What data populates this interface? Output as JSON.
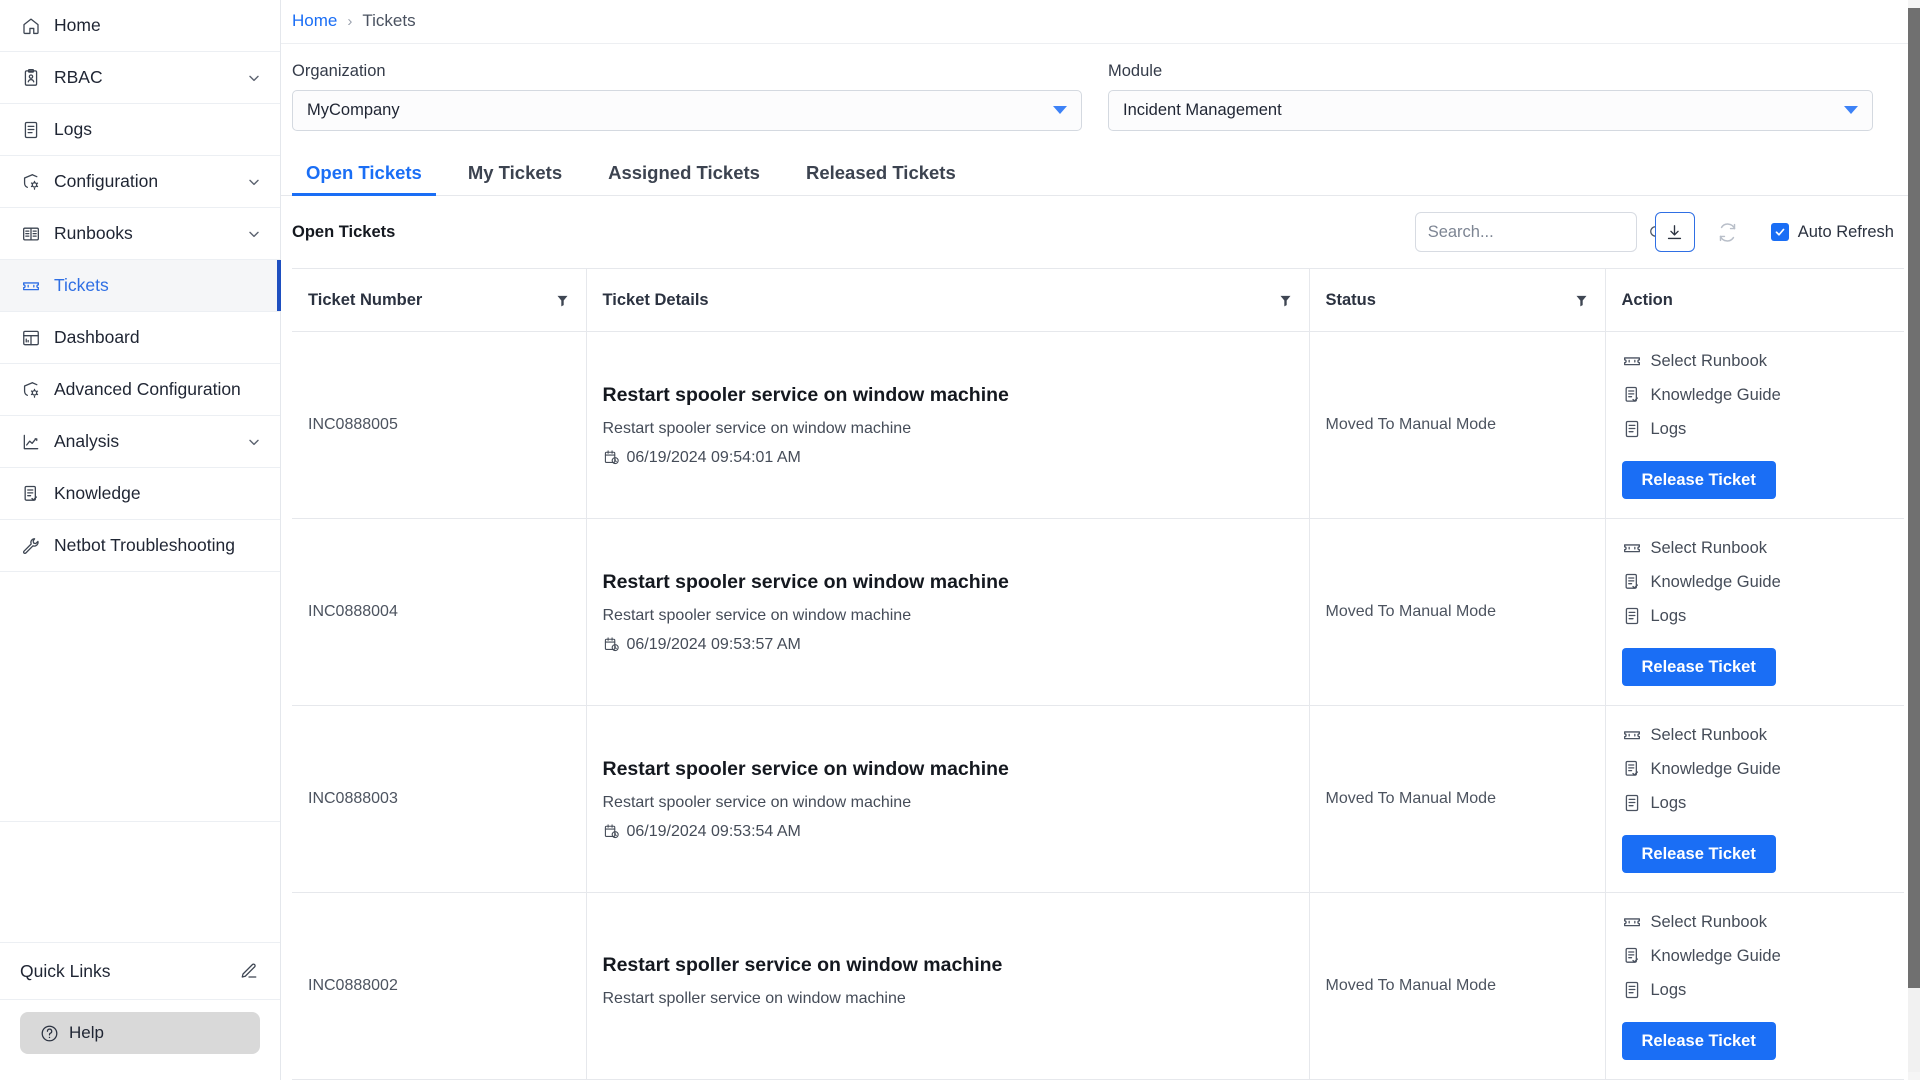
{
  "sidebar": {
    "items": [
      {
        "label": "Home",
        "icon": "home-icon",
        "expandable": false,
        "active": false
      },
      {
        "label": "RBAC",
        "icon": "clipboard-user-icon",
        "expandable": true,
        "active": false
      },
      {
        "label": "Logs",
        "icon": "file-lines-icon",
        "expandable": false,
        "active": false
      },
      {
        "label": "Configuration",
        "icon": "gear-settings-icon",
        "expandable": true,
        "active": false
      },
      {
        "label": "Runbooks",
        "icon": "book-open-icon",
        "expandable": true,
        "active": false
      },
      {
        "label": "Tickets",
        "icon": "ticket-icon",
        "expandable": false,
        "active": true
      },
      {
        "label": "Dashboard",
        "icon": "dashboard-grid-icon",
        "expandable": false,
        "active": false
      },
      {
        "label": "Advanced Configuration",
        "icon": "gear-settings-icon",
        "expandable": false,
        "active": false
      },
      {
        "label": "Analysis",
        "icon": "chart-line-icon",
        "expandable": true,
        "active": false
      },
      {
        "label": "Knowledge",
        "icon": "file-check-icon",
        "expandable": false,
        "active": false
      },
      {
        "label": "Netbot Troubleshooting",
        "icon": "wrench-icon",
        "expandable": false,
        "active": false
      }
    ],
    "quick_links": {
      "label": "Quick Links",
      "edit_icon": "pencil-icon"
    },
    "help": {
      "label": "Help",
      "icon": "question-circle-icon"
    }
  },
  "breadcrumb": {
    "home": "Home",
    "separator": "›",
    "current": "Tickets"
  },
  "filters": {
    "organization": {
      "label": "Organization",
      "value": "MyCompany"
    },
    "module": {
      "label": "Module",
      "value": "Incident Management"
    }
  },
  "tabs": [
    {
      "label": "Open Tickets",
      "active": true
    },
    {
      "label": "My Tickets",
      "active": false
    },
    {
      "label": "Assigned Tickets",
      "active": false
    },
    {
      "label": "Released Tickets",
      "active": false
    }
  ],
  "panel": {
    "title": "Open Tickets",
    "search_placeholder": "Search...",
    "search_value": "",
    "download_icon": "download-icon",
    "refresh_icon": "refresh-icon",
    "auto_refresh_label": "Auto Refresh",
    "auto_refresh_checked": true
  },
  "table": {
    "columns": [
      {
        "label": "Ticket Number",
        "filter": true
      },
      {
        "label": "Ticket Details",
        "filter": true
      },
      {
        "label": "Status",
        "filter": true
      },
      {
        "label": "Action",
        "filter": false
      }
    ],
    "rows": [
      {
        "number": "INC0888005",
        "title": "Restart spooler service on window machine",
        "subtitle": "Restart spooler service on window machine",
        "date": "06/19/2024 09:54:01 AM",
        "status": "Moved To Manual Mode",
        "actions": [
          {
            "label": "Select Runbook",
            "icon": "ticket-icon"
          },
          {
            "label": "Knowledge Guide",
            "icon": "file-check-icon"
          },
          {
            "label": "Logs",
            "icon": "file-lines-icon"
          }
        ],
        "release_label": "Release Ticket"
      },
      {
        "number": "INC0888004",
        "title": "Restart spooler service on window machine",
        "subtitle": "Restart spooler service on window machine",
        "date": "06/19/2024 09:53:57 AM",
        "status": "Moved To Manual Mode",
        "actions": [
          {
            "label": "Select Runbook",
            "icon": "ticket-icon"
          },
          {
            "label": "Knowledge Guide",
            "icon": "file-check-icon"
          },
          {
            "label": "Logs",
            "icon": "file-lines-icon"
          }
        ],
        "release_label": "Release Ticket"
      },
      {
        "number": "INC0888003",
        "title": "Restart spooler service on window machine",
        "subtitle": "Restart spooler service on window machine",
        "date": "06/19/2024 09:53:54 AM",
        "status": "Moved To Manual Mode",
        "actions": [
          {
            "label": "Select Runbook",
            "icon": "ticket-icon"
          },
          {
            "label": "Knowledge Guide",
            "icon": "file-check-icon"
          },
          {
            "label": "Logs",
            "icon": "file-lines-icon"
          }
        ],
        "release_label": "Release Ticket"
      },
      {
        "number": "INC0888002",
        "title": "Restart spoller service on window machine",
        "subtitle": "Restart spoller service on window machine",
        "date": "",
        "status": "Moved To Manual Mode",
        "actions": [
          {
            "label": "Select Runbook",
            "icon": "ticket-icon"
          },
          {
            "label": "Knowledge Guide",
            "icon": "file-check-icon"
          },
          {
            "label": "Logs",
            "icon": "file-lines-icon"
          }
        ],
        "release_label": "Release Ticket"
      }
    ]
  },
  "colors": {
    "accent": "#1a6ef5",
    "active_indicator": "#1e4fc0",
    "border": "#e6e8ec",
    "text": "#1f2533"
  }
}
